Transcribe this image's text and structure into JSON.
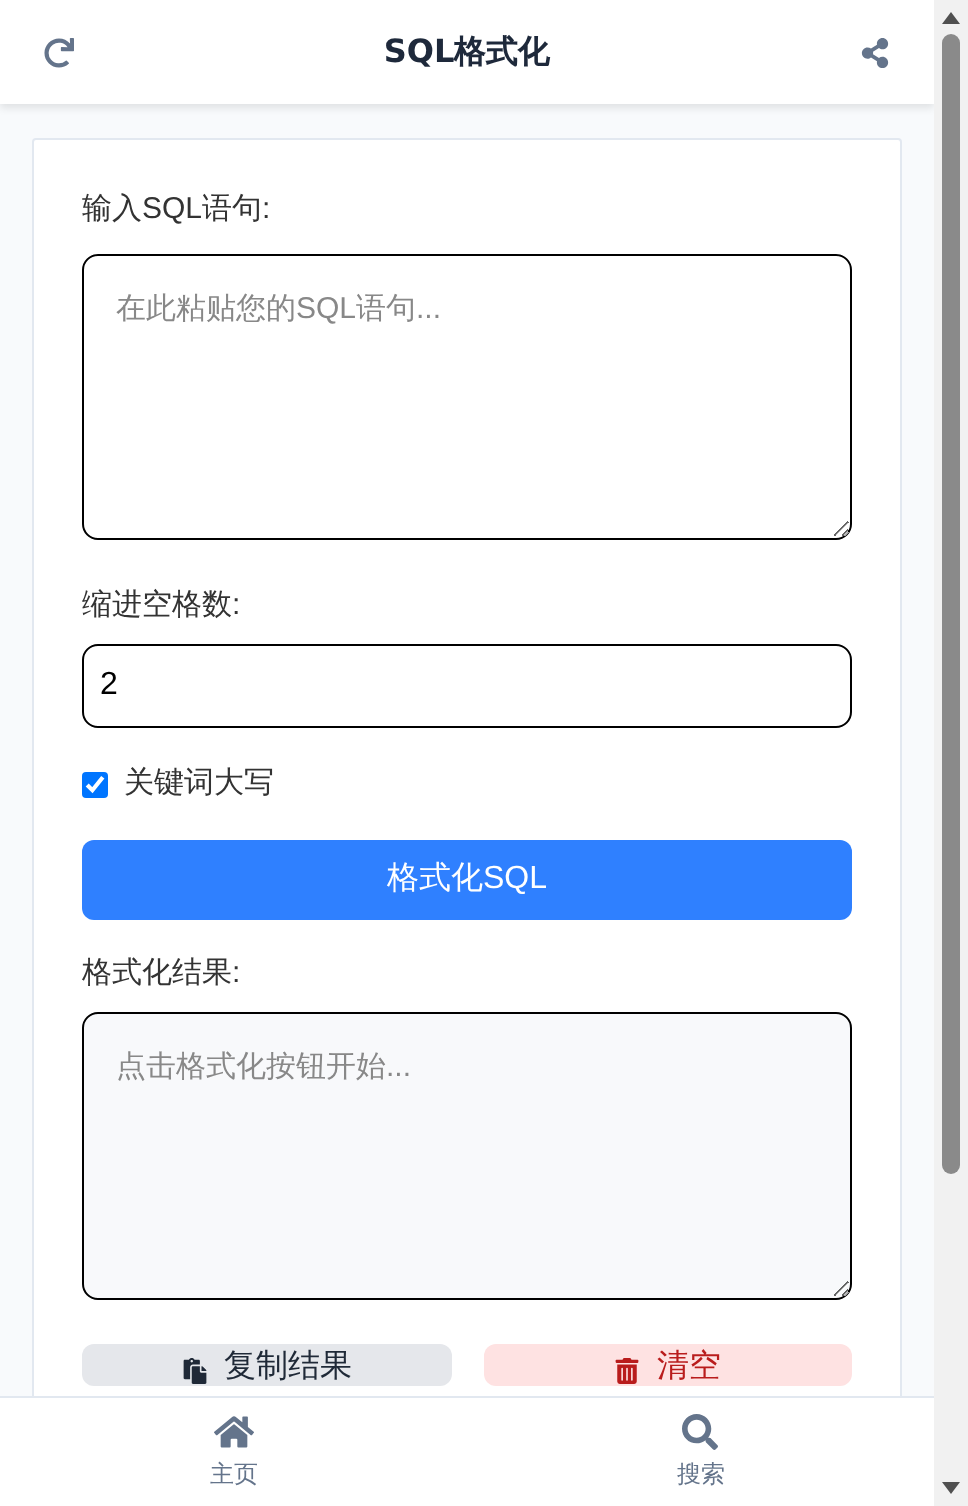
{
  "header": {
    "title": "SQL格式化"
  },
  "input": {
    "label": "输入SQL语句:",
    "placeholder": "在此粘贴您的SQL语句..."
  },
  "indent": {
    "label": "缩进空格数:",
    "value": "2"
  },
  "uppercase": {
    "label": "关键词大写",
    "checked": true
  },
  "format_button": "格式化SQL",
  "result": {
    "label": "格式化结果:",
    "placeholder": "点击格式化按钮开始..."
  },
  "actions": [
    {
      "kind": "copy",
      "label": "复制结果"
    },
    {
      "kind": "clear",
      "label": "清空"
    }
  ],
  "bottom_nav": [
    {
      "kind": "home",
      "label": "主页"
    },
    {
      "kind": "search",
      "label": "搜索"
    }
  ]
}
